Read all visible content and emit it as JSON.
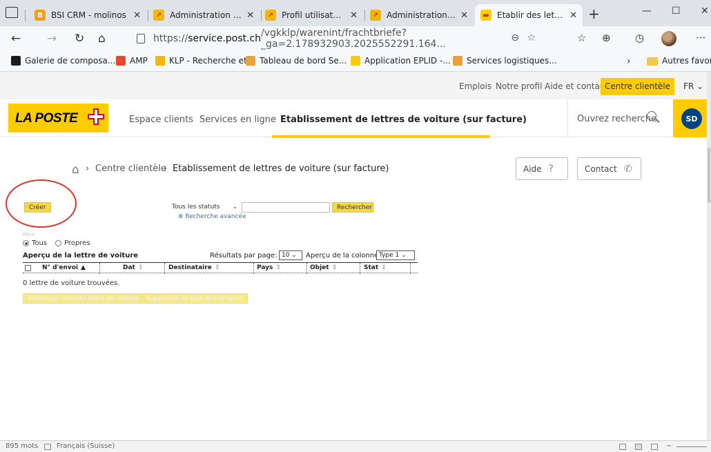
{
  "browser": {
    "tabs": [
      {
        "title": "BSI CRM - molinos",
        "color": "#f0a020",
        "icon": "crm-icon"
      },
      {
        "title": "Administration KLP",
        "color": "#f2b705",
        "icon": "klp-icon"
      },
      {
        "title": "Profil utilisateur - L",
        "color": "#f2b705",
        "icon": "klp-icon"
      },
      {
        "title": "Administration KLP",
        "color": "#f2b705",
        "icon": "klp-icon"
      },
      {
        "title": "Etablir des lettres d",
        "color": "#ffcc00",
        "icon": "post-icon"
      }
    ],
    "url_prefix": "https://",
    "url_host": "service.post.ch",
    "url_rest": "/vgkklp/warenint/frachtbriefe?_ga=2.178932903.2025552291.164...",
    "bookmarks": [
      {
        "label": "Galerie de composa...",
        "color": "#1b1b1b"
      },
      {
        "label": "AMP",
        "color": "#e04a2f"
      },
      {
        "label": "KLP - Recherche et...",
        "color": "#f2b705"
      },
      {
        "label": "Tableau de bord Se...",
        "color": "#e9a23b"
      },
      {
        "label": "Application EPLID -...",
        "color": "#ffcc00"
      },
      {
        "label": "Services logistiques...",
        "color": "#e9a23b"
      }
    ],
    "other_favorites": "Autres favoris"
  },
  "site": {
    "util_links": [
      "Emplois",
      "Notre profil",
      "Aide et contact"
    ],
    "util_cta": "Centre clientèle",
    "language": "FR",
    "logo_text": "LA POSTE",
    "nav": [
      "Espace clients",
      "Services en ligne",
      "Etablissement de lettres de voiture (sur facture)"
    ],
    "search_label": "Ouvrez recherche",
    "user_initials": "SD",
    "brand_color": "#ffcc00",
    "breadcrumb": [
      "Centre clientèle",
      "Etablissement de lettres de voiture (sur facture)"
    ],
    "help_label": "Aide",
    "contact_label": "Contact"
  },
  "app": {
    "create_label": "Créer",
    "status_select": "Tous les statuts",
    "search_button": "Rechercher",
    "advanced_search": "Recherche avancée",
    "filter_faint": "Filtre",
    "radio_all": "Tous",
    "radio_own": "Propres",
    "section_title": "Aperçu de la lettre de voiture",
    "results_per_page_label": "Résultats par page:",
    "results_per_page": "10",
    "column_view_label": "Aperçu de la colonne",
    "column_view": "Type 1",
    "columns": [
      "N° d'envoi",
      "Dat",
      "Destinataire",
      "Pays",
      "Objet",
      "Stat"
    ],
    "result_text": "0 lettre de voiture trouvées.",
    "btn_collective": "Bordereau collectif lettre de voiture",
    "btn_delete": "Supprimer un bon de transport"
  },
  "statusbar": {
    "words": "895 mots",
    "language": "Français (Suisse)"
  }
}
